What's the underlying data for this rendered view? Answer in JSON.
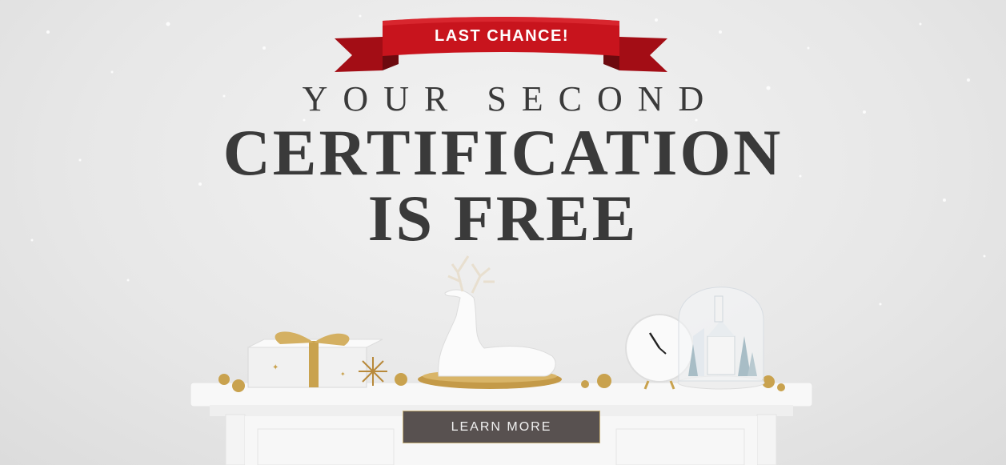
{
  "banner": {
    "label": "LAST CHANCE!"
  },
  "headline": {
    "line1": "YOUR SECOND",
    "line2": "CERTIFICATION",
    "line3": "IS FREE"
  },
  "cta": {
    "label": "LEARN MORE"
  },
  "colors": {
    "ribbon": "#c8141d",
    "headline": "#3a3a3a",
    "button_bg": "#585150",
    "button_border": "#c9b27a",
    "gold": "#c9a24e"
  }
}
